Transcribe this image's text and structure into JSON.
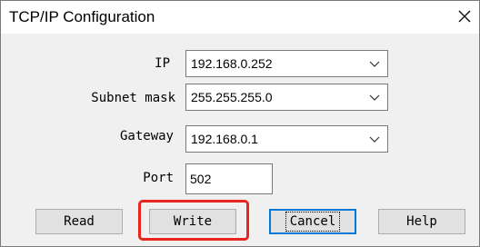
{
  "window": {
    "title": "TCP/IP Configuration",
    "close_icon": "close-icon"
  },
  "form": {
    "ip": {
      "label": "IP",
      "value": "192.168.0.252"
    },
    "subnet": {
      "label": "Subnet mask",
      "value": "255.255.255.0"
    },
    "gateway": {
      "label": "Gateway",
      "value": "192.168.0.1"
    },
    "port": {
      "label": "Port",
      "value": "502"
    }
  },
  "buttons": {
    "read": "Read",
    "write": "Write",
    "cancel": "Cancel",
    "help": "Help"
  },
  "colors": {
    "highlight": "#e8261f",
    "focus_border": "#0078d7"
  }
}
